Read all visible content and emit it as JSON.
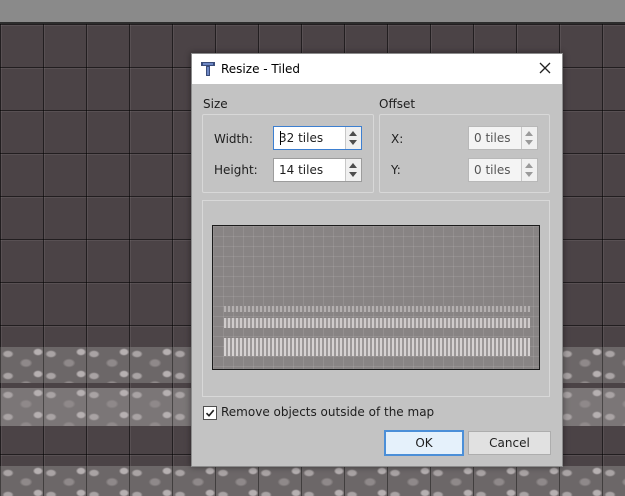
{
  "dialog": {
    "title": "Resize - Tiled",
    "size_group": {
      "title": "Size",
      "width_label": "Width:",
      "width_value": "32 tiles",
      "height_label": "Height:",
      "height_value": "14 tiles"
    },
    "offset_group": {
      "title": "Offset",
      "x_label": "X:",
      "x_value": "0 tiles",
      "y_label": "Y:",
      "y_value": "0 tiles"
    },
    "remove_objects": {
      "label": "Remove objects outside of the map",
      "checked": true
    },
    "ok_label": "OK",
    "cancel_label": "Cancel"
  },
  "colors": {
    "map_background": "#4b4346",
    "dialog_background": "#c3c3c3",
    "focus_accent": "#3d7fd0"
  },
  "icons": [
    "tiled-app-icon",
    "close-icon",
    "spin-up-icon",
    "spin-down-icon",
    "checkmark-icon"
  ]
}
